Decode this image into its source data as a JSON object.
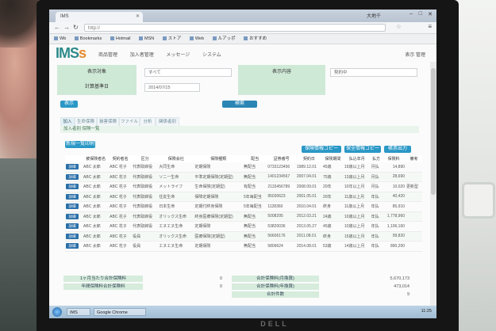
{
  "browser": {
    "tab_title": "IMS",
    "url": "http://",
    "user": "大地千",
    "bookmarks": [
      "Wb",
      "Bookmarks",
      "Hotmail",
      "MSN",
      "ストア",
      "Web",
      "ルアッポ",
      "おすすめ"
    ]
  },
  "app": {
    "logo_main": "IMS",
    "logo_accent": "s",
    "nav": [
      "商品管理",
      "加入者管理",
      "メッセージ",
      "システム"
    ],
    "logout": "表示 管理"
  },
  "filter": {
    "label_target": "表示対象",
    "label_date": "計算基準日",
    "label_content": "表示内容",
    "target_value": "すべて",
    "date_value": "2014/07/15",
    "content_value": "契約中",
    "button_small": "表示",
    "button_search": "検索"
  },
  "tabs": [
    "加入",
    "生命保険",
    "損害保険",
    "ファイル",
    "分析",
    "関係者別"
  ],
  "section_title": "加入者別 保険一覧",
  "actions": {
    "new_button": "新規一覧印刷",
    "copy_button_1": "保険情報コピー",
    "copy_button_2": "保全情報コピー",
    "output_button": "帳票出力"
  },
  "table": {
    "headers": [
      "",
      "被保険者名",
      "契約者名",
      "区分",
      "保険会社",
      "保険種類",
      "配当",
      "証券番号",
      "契約日",
      "保険期間",
      "払込年月",
      "払方",
      "保険料",
      "備考"
    ],
    "detail_label": "詳細",
    "rows": [
      [
        "ABC 太郎",
        "ABC 花子",
        "代表取締役",
        "大同生命",
        "定期保険",
        "無配当",
        "0733123456",
        "1989.12.01",
        "45歳",
        "19歳以上月",
        "月払",
        "14,890",
        ""
      ],
      [
        "ABC 太郎",
        "ABC 花子",
        "代表取締役",
        "ソニー生命",
        "平準定期保険(定期型)",
        "無配当",
        "1401234567",
        "2007.04.01",
        "75歳",
        "13歳以上月",
        "月払",
        "28,690",
        ""
      ],
      [
        "ABC 太郎",
        "ABC 花子",
        "代表取締役",
        "メットライフ",
        "生命保険(定期型)",
        "有配当",
        "2133456789",
        "2008.09.01",
        "20年",
        "10年以上月",
        "月払",
        "10,020",
        "更新型"
      ],
      [
        "ABC 太郎",
        "ABC 花子",
        "代表取締役",
        "住友生命",
        "保障定期保険",
        "5年毎配当",
        "95030623",
        "2001.05.01",
        "20年",
        "11歳以上月",
        "年払",
        "40,420",
        ""
      ],
      [
        "ABC 太郎",
        "ABC 花子",
        "代表取締役",
        "日本生命",
        "定期付終身保険",
        "5年毎配当",
        "1128360",
        "2010.04.01",
        "終身",
        "11歳以上月",
        "年払",
        "85,910",
        ""
      ],
      [
        "ABC 太郎",
        "ABC 花子",
        "代表取締役",
        "オリックス生命",
        "終身医療保険(定期型)",
        "無配当",
        "5008295",
        "2012.03.21",
        "24歳",
        "10歳以上月",
        "年払",
        "1,778,960",
        ""
      ],
      [
        "ABC 太郎",
        "ABC 花子",
        "代表取締役",
        "エヌエヌ生命",
        "定期保険",
        "無配当",
        "53820036",
        "2013.05.27",
        "45歳",
        "10歳以上月",
        "年払",
        "1,106,160",
        ""
      ],
      [
        "ABC 太郎",
        "ABC 花子",
        "役員",
        "オリックス生命",
        "医療保険(定期型)",
        "無配当",
        "56606176",
        "2011.08.01",
        "終身",
        "15歳以上月",
        "年払",
        "99,820",
        ""
      ],
      [
        "ABC 太郎",
        "ABC 花子",
        "役員",
        "エヌエヌ生命",
        "定期保険",
        "無配当",
        "5809624",
        "2014.08.01",
        "53歳",
        "14歳以上月",
        "年払",
        "890,200",
        ""
      ]
    ]
  },
  "summary": {
    "left_label_1": "1ヶ月当たり合計保険料",
    "left_label_2": "年間保険料合計保険料",
    "left_value_1": "0",
    "left_value_2": "0",
    "right_label_1": "合計保険料(月換算)",
    "right_label_2": "合計保険料(年換算)",
    "right_label_3": "合計件数",
    "right_value_1": "5,670,173",
    "right_value_2": "473,014",
    "right_value_3": "9"
  },
  "taskbar": {
    "item_1": "IMS",
    "item_2": "Google Chrome",
    "clock": "11:25"
  },
  "monitor_brand": "DELL",
  "colors": {
    "accent": "#2a98c6",
    "label_bg": "#cfe9d7",
    "logo": "#2e8a8a",
    "logo_accent": "#e58a2e"
  }
}
